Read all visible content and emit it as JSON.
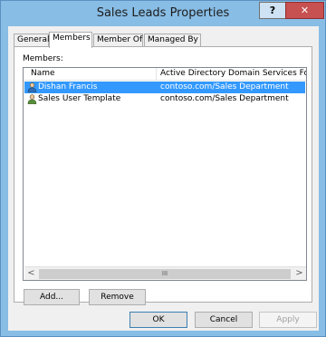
{
  "window": {
    "title": "Sales Leads Properties",
    "help_label": "?",
    "close_label": "✕"
  },
  "tabs": [
    {
      "label": "General"
    },
    {
      "label": "Members"
    },
    {
      "label": "Member Of"
    },
    {
      "label": "Managed By"
    }
  ],
  "members": {
    "label": "Members:",
    "columns": [
      "Name",
      "Active Directory Domain Services Folder"
    ],
    "rows": [
      {
        "name": "Dishan Francis",
        "folder": "contoso.com/Sales Department",
        "icon": "user-icon",
        "selected": true
      },
      {
        "name": "Sales User Template",
        "folder": "contoso.com/Sales Department",
        "icon": "user-icon",
        "selected": false
      }
    ],
    "scroll_left": "<",
    "scroll_right": ">",
    "scroll_grip": "III"
  },
  "buttons": {
    "add": "Add...",
    "remove": "Remove",
    "ok": "OK",
    "cancel": "Cancel",
    "apply": "Apply"
  },
  "colors": {
    "selection": "#3399ff",
    "frame": "#88bde5",
    "close_button": "#c75050"
  }
}
